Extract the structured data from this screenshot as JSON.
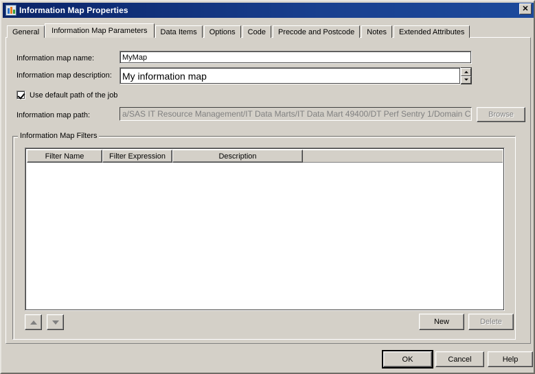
{
  "window": {
    "title": "Information Map Properties",
    "icon": "information-map-icon",
    "close_label": "✕"
  },
  "tabs": [
    {
      "label": "General",
      "active": false
    },
    {
      "label": "Information Map Parameters",
      "active": true
    },
    {
      "label": "Data Items",
      "active": false
    },
    {
      "label": "Options",
      "active": false
    },
    {
      "label": "Code",
      "active": false
    },
    {
      "label": "Precode and Postcode",
      "active": false
    },
    {
      "label": "Notes",
      "active": false
    },
    {
      "label": "Extended Attributes",
      "active": false
    }
  ],
  "form": {
    "name_label": "Information map name:",
    "name_value": "MyMap",
    "description_label": "Information map description:",
    "description_value": "My information map",
    "use_default_path_label": "Use default path of the job",
    "use_default_path_checked": true,
    "path_label": "Information map path:",
    "path_value": "a/SAS IT Resource Management/IT Data Marts/IT Data Mart 49400/DT Perf Sentry 1/Domain Categories/",
    "browse_label": "Browse",
    "browse_enabled": false
  },
  "filters": {
    "group_label": "Information Map Filters",
    "columns": [
      "Filter Name",
      "Filter Expression",
      "Description"
    ],
    "rows": [],
    "move_up_label": "▲",
    "move_down_label": "▼",
    "new_label": "New",
    "delete_label": "Delete",
    "new_enabled": true,
    "delete_enabled": false
  },
  "footer": {
    "ok_label": "OK",
    "cancel_label": "Cancel",
    "help_label": "Help"
  },
  "colors": {
    "titlebar": "#0a2468",
    "dialog_background": "#d4d0c8",
    "field_background": "#ffffff",
    "disabled_text": "#808080"
  }
}
